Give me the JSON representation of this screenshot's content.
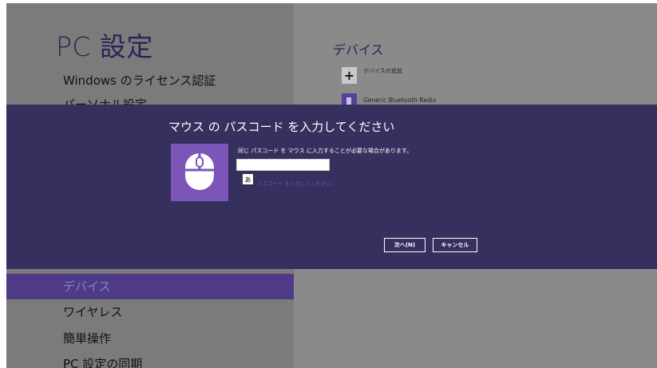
{
  "settings": {
    "title": "PC 設定",
    "nav": [
      {
        "label": "Windows のライセンス認証"
      },
      {
        "label": "パーソナル設定"
      },
      {
        "label": "デバイス"
      },
      {
        "label": "ワイヤレス"
      },
      {
        "label": "簡単操作"
      },
      {
        "label": "PC 設定の同期"
      }
    ],
    "selected_nav": "デバイス"
  },
  "devices": {
    "heading": "デバイス",
    "add_label": "デバイスの追加",
    "add_symbol": "+",
    "items": [
      {
        "label": "Generic Bluetooth Radio"
      }
    ]
  },
  "dialog": {
    "title": "マウス の パスコード を入力してください",
    "instruction": "同じ パスコード を マウス に入力することが必要な場合があります。",
    "input_value": "",
    "ime_indicator": "あ",
    "hint": "パスコード を入力してください。",
    "next_label": "次へ(N)",
    "cancel_label": "キャンセル",
    "device_icon": "mouse-icon"
  },
  "colors": {
    "accent": "#4e3a86",
    "dialog_bg": "#35305e",
    "tile": "#7b56b8"
  }
}
